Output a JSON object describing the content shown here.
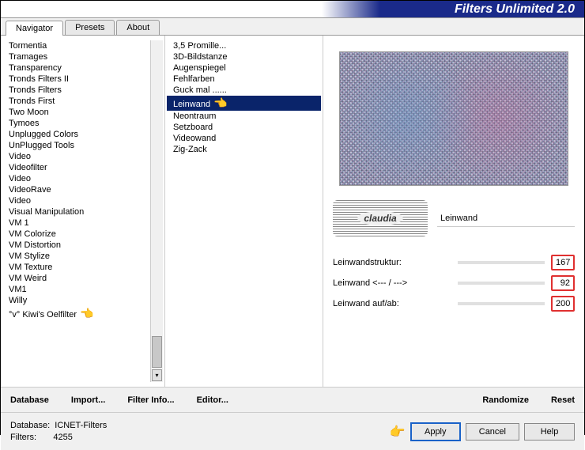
{
  "title": "Filters Unlimited 2.0",
  "tabs": [
    "Navigator",
    "Presets",
    "About"
  ],
  "active_tab": 0,
  "categories": [
    "Tormentia",
    "Tramages",
    "Transparency",
    "Tronds Filters II",
    "Tronds Filters",
    "Tronds First",
    "Two Moon",
    "Tymoes",
    "Unplugged Colors",
    "UnPlugged Tools",
    "Video",
    "Videofilter",
    "Video",
    "VideoRave",
    "Video",
    "Visual Manipulation",
    "VM 1",
    "VM Colorize",
    "VM Distortion",
    "VM Stylize",
    "VM Texture",
    "VM Weird",
    "VM1",
    "Willy",
    "°v° Kiwi's Oelfilter"
  ],
  "selected_category_index": 24,
  "filters": [
    "3,5 Promille...",
    "3D-Bildstanze",
    "Augenspiegel",
    "Fehlfarben",
    "Guck mal ......",
    "Leinwand",
    "Neontraum",
    "Setzboard",
    "Videowand",
    "Zig-Zack"
  ],
  "selected_filter_index": 5,
  "filter_title": "Leinwand",
  "params": [
    {
      "label": "Leinwandstruktur:",
      "value": "167"
    },
    {
      "label": "Leinwand <--- / --->",
      "value": "92"
    },
    {
      "label": "Leinwand auf/ab:",
      "value": "200"
    }
  ],
  "toolbar": {
    "database": "Database",
    "import": "Import...",
    "filterinfo": "Filter Info...",
    "editor": "Editor...",
    "randomize": "Randomize",
    "reset": "Reset"
  },
  "footer": {
    "db_label": "Database:",
    "db_value": "ICNET-Filters",
    "filters_label": "Filters:",
    "filters_value": "4255",
    "apply": "Apply",
    "cancel": "Cancel",
    "help": "Help"
  },
  "watermark": "claudia"
}
